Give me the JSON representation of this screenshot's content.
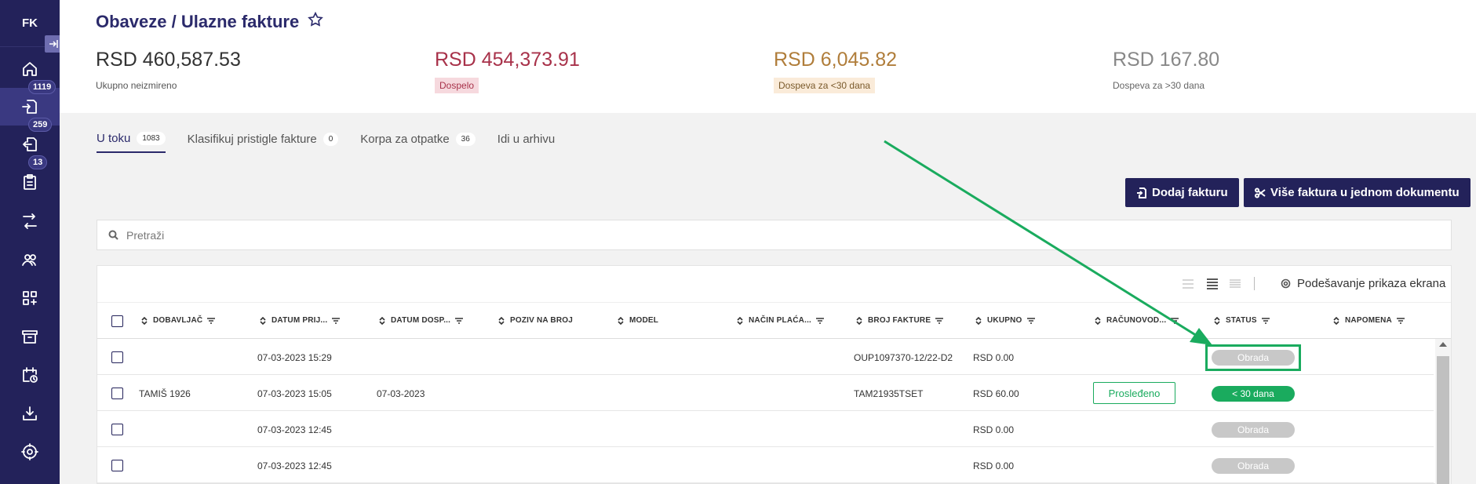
{
  "sidebar": {
    "logo": "FK",
    "badges": {
      "inbox": "1119",
      "outbox": "259",
      "tasks": "13"
    }
  },
  "header": {
    "title": "Obaveze / Ulazne fakture",
    "stats": [
      {
        "value": "RSD 460,587.53",
        "label": "Ukupno neizmireno",
        "color": "#333333"
      },
      {
        "value": "RSD 454,373.91",
        "label": "Dospelo",
        "color": "#a8324a",
        "label_bg": "#f6d9de"
      },
      {
        "value": "RSD 6,045.82",
        "label": "Dospeva za <30 dana",
        "color": "#b07d3a",
        "label_bg": "#faebd9"
      },
      {
        "value": "RSD 167.80",
        "label": "Dospeva za >30 dana",
        "color": "#888888"
      }
    ]
  },
  "tabs": [
    {
      "label": "U toku",
      "count": "1083",
      "active": true
    },
    {
      "label": "Klasifikuj pristigle fakture",
      "count": "0"
    },
    {
      "label": "Korpa za otpatke",
      "count": "36"
    },
    {
      "label": "Idi u arhivu"
    }
  ],
  "actions": {
    "add_invoice": "Dodaj fakturu",
    "multi_invoice": "Više faktura u jednom dokumentu"
  },
  "search": {
    "placeholder": "Pretraži"
  },
  "toolbar": {
    "settings_label": "Podešavanje prikaza ekrana"
  },
  "table": {
    "columns": [
      "DOBAVLJAČ",
      "DATUM PRIJ...",
      "DATUM DOSP...",
      "POZIV NA BROJ",
      "MODEL",
      "NAČIN PLAĆA...",
      "BROJ FAKTURE",
      "UKUPNO",
      "RAČUNOVOD...",
      "STATUS",
      "NAPOMENA"
    ],
    "rows": [
      {
        "supplier": "",
        "received": "07-03-2023 15:29",
        "due": "",
        "invoice_no": "OUP1097370-12/22-D2",
        "total": "RSD 0.00",
        "accounting": "",
        "status": "Obrada",
        "status_type": "gray"
      },
      {
        "supplier": "TAMIŠ 1926",
        "received": "07-03-2023 15:05",
        "due": "07-03-2023",
        "invoice_no": "TAM21935TSET",
        "total": "RSD 60.00",
        "accounting": "Prosleđeno",
        "status": "< 30 dana",
        "status_type": "green"
      },
      {
        "supplier": "",
        "received": "07-03-2023 12:45",
        "due": "",
        "invoice_no": "",
        "total": "RSD 0.00",
        "accounting": "",
        "status": "Obrada",
        "status_type": "gray"
      },
      {
        "supplier": "",
        "received": "07-03-2023 12:45",
        "due": "",
        "invoice_no": "",
        "total": "RSD 0.00",
        "accounting": "",
        "status": "Obrada",
        "status_type": "gray"
      }
    ]
  },
  "annotation": {
    "color": "#1aab5e"
  }
}
